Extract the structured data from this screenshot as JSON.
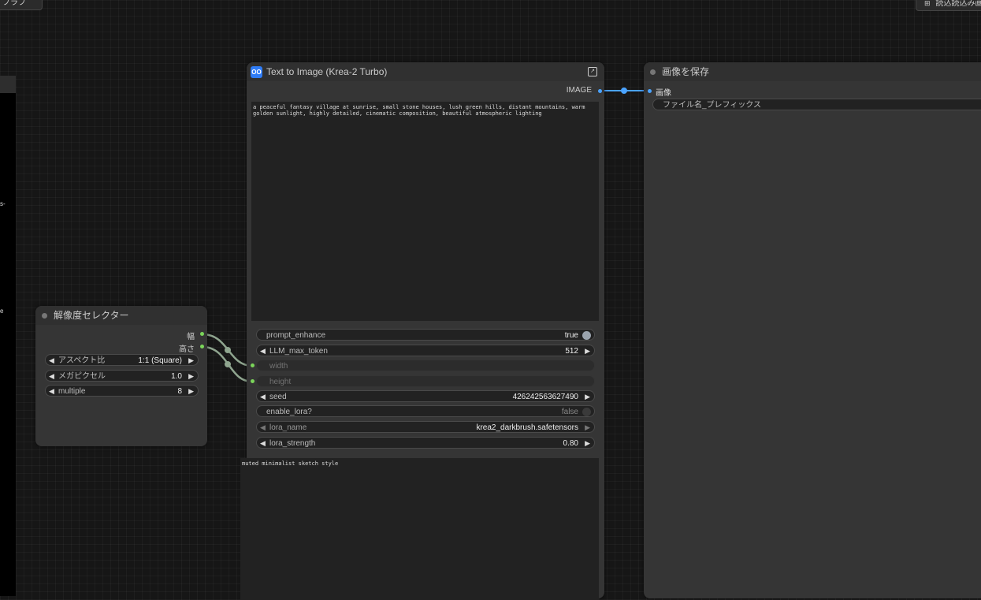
{
  "top_left_button": {
    "label": "ブラブ"
  },
  "top_right_button": {
    "label": "読込読込み画"
  },
  "left_panel": {
    "text1": "s-",
    "text2": "e"
  },
  "resolution_node": {
    "title": "解像度セレクター",
    "outputs": [
      "幅",
      "高さ"
    ],
    "widgets": [
      {
        "label": "アスペクト比",
        "value": "1:1 (Square)"
      },
      {
        "label": "メガピクセル",
        "value": "1.0"
      },
      {
        "label": "multiple",
        "value": "8"
      }
    ]
  },
  "t2i_node": {
    "title": "Text to Image (Krea-2 Turbo)",
    "output_label": "IMAGE",
    "prompt": "a peaceful fantasy village at sunrise, small stone houses, lush green hills, distant mountains, warm golden sunlight, highly detailed, cinematic composition, beautiful atmospheric lighting",
    "widgets": {
      "prompt_enhance": {
        "label": "prompt_enhance",
        "value": "true"
      },
      "llm_max_token": {
        "label": "LLM_max_token",
        "value": "512"
      },
      "width": {
        "label": "width"
      },
      "height": {
        "label": "height"
      },
      "seed": {
        "label": "seed",
        "value": "426242563627490"
      },
      "enable_lora": {
        "label": "enable_lora?",
        "value": "false"
      },
      "lora_name": {
        "label": "lora_name",
        "value": "krea2_darkbrush.safetensors"
      },
      "lora_strength": {
        "label": "lora_strength",
        "value": "0.80"
      }
    },
    "style_prompt": "muted minimalist sketch style"
  },
  "save_node": {
    "title": "画像を保存",
    "input_label": "画像",
    "filename_prefix": "ファイル名_プレフィックス"
  },
  "colors": {
    "link_image": "#4aa3ff",
    "link_int": "#8fa58f",
    "slot_int": "#7bd55a",
    "accent_icon": "#2f7cf6"
  }
}
